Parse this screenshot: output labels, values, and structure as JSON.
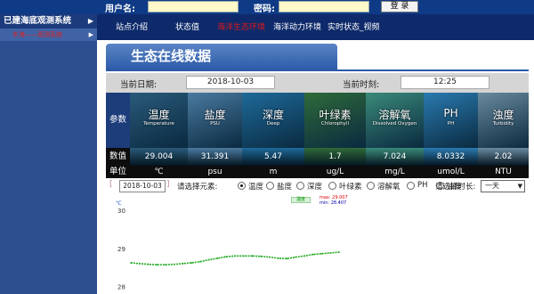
{
  "login": {
    "username_label": "用户名:",
    "username_value": "",
    "password_label": "密码:",
    "password_value": "",
    "login_button": "登 录"
  },
  "sidebar": {
    "title": "已建海底观测系统",
    "subitem": "东海——观测系统"
  },
  "nav": {
    "items": [
      "站点介绍",
      "状态值",
      "海洋生态环境",
      "海洋动力环境",
      "实时状态_视频"
    ],
    "active_index": 2
  },
  "page_title": "生态在线数据",
  "date_row": {
    "date_label": "当前日期:",
    "date_value": "2018-10-03",
    "time_label": "当前时刻:",
    "time_value": "12:25"
  },
  "table": {
    "param_label": "参数",
    "value_label": "数值",
    "unit_label": "单位",
    "params": [
      {
        "name": "温度",
        "en": "Temperature",
        "value": "29.004",
        "unit": "℃",
        "color": "#2a5a7a"
      },
      {
        "name": "盐度",
        "en": "PSU",
        "value": "31.391",
        "unit": "psu",
        "color": "#4a7aa0"
      },
      {
        "name": "深度",
        "en": "Deep",
        "value": "5.47",
        "unit": "m",
        "color": "#1e6a9a"
      },
      {
        "name": "叶绿素",
        "en": "Chlorophyll",
        "value": "1.7",
        "unit": "ug/L",
        "color": "#2f6a3a"
      },
      {
        "name": "溶解氧",
        "en": "Dissolved Oxygen",
        "value": "7.024",
        "unit": "mg/L",
        "color": "#3a8a7a"
      },
      {
        "name": "PH",
        "en": "PH",
        "value": "8.0332",
        "unit": "umol/L",
        "color": "#2a7ab0"
      },
      {
        "name": "浊度",
        "en": "Turbidity",
        "value": "2.02",
        "unit": "NTU",
        "color": "#6a8aa0"
      }
    ]
  },
  "controls": {
    "date_value": "2018-10-03",
    "element_label": "请选择元素:",
    "radios": [
      "温度",
      "盐度",
      "深度",
      "叶绿素",
      "溶解氧",
      "PH",
      "浊度"
    ],
    "selected_index": 0,
    "duration_label": "请选择时长:",
    "duration_value": "一天"
  },
  "chart_data": {
    "type": "line",
    "ylabel": "℃",
    "ytick_labels": [
      "30",
      "29",
      "28"
    ],
    "ylim": [
      27.8,
      30.4
    ],
    "series": [
      {
        "name": "温度",
        "color": "#22aa22",
        "values": [
          28.62,
          28.6,
          28.58,
          28.57,
          28.57,
          28.58,
          28.6,
          28.62,
          28.65,
          28.7,
          28.74,
          28.78,
          28.8,
          28.8,
          28.8,
          28.79,
          28.77,
          28.74,
          28.73,
          28.77,
          28.8,
          28.84,
          28.86,
          28.88,
          28.9
        ]
      }
    ],
    "max_label": "max: 29.007",
    "min_label": "min: 28.407"
  }
}
